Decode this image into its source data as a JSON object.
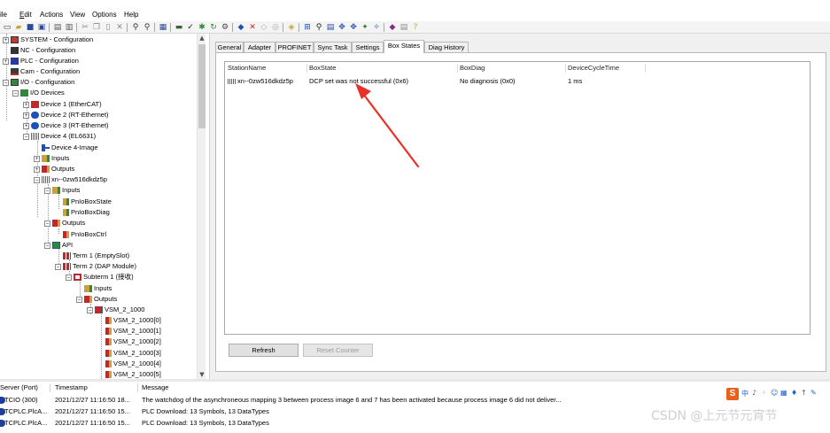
{
  "menu": [
    "ile",
    "Edit",
    "Actions",
    "View",
    "Options",
    "Help"
  ],
  "menu_underline": [
    "",
    "E",
    "A",
    "V",
    "O",
    "H"
  ],
  "toolbar_icons": [
    "new-icon",
    "open-icon",
    "save-icon",
    "save-all-icon",
    "print-icon",
    "print-preview-icon",
    "cut-icon",
    "copy-icon",
    "paste-icon",
    "delete-icon",
    "find-icon",
    "find-next-icon",
    "goto-icon",
    "generate-mappings-icon",
    "check-config-icon",
    "activate-config-icon",
    "restart-icon",
    "login-icon",
    "start-icon",
    "stop-icon",
    "free-run-icon",
    "force-icon",
    "scan-icon",
    "toggle-icon",
    "show-online-icon",
    "zoom-icon",
    "ethercat-icon",
    "online-icon",
    "link-icon",
    "book-icon",
    "help-icon"
  ],
  "tree": [
    {
      "label": "SYSTEM - Configuration",
      "icon": "system-icon",
      "exp": "+"
    },
    {
      "label": "NC - Configuration",
      "icon": "nc-icon",
      "exp": ""
    },
    {
      "label": "PLC - Configuration",
      "icon": "plc-icon",
      "exp": "+"
    },
    {
      "label": "Cam - Configuration",
      "icon": "cam-icon",
      "exp": ""
    },
    {
      "label": "I/O - Configuration",
      "icon": "io-icon",
      "exp": "−"
    },
    {
      "label": "I/O Devices",
      "icon": "io-devices-icon",
      "exp": "−"
    },
    {
      "label": "Device 1 (EtherCAT)",
      "icon": "ethercat-device-icon",
      "exp": "+"
    },
    {
      "label": "Device 2 (RT-Ethernet)",
      "icon": "rt-ethernet-icon",
      "exp": "+"
    },
    {
      "label": "Device 3 (RT-Ethernet)",
      "icon": "rt-ethernet-icon",
      "exp": "+"
    },
    {
      "label": "Device 4 (EL6631)",
      "icon": "profinet-device-icon",
      "exp": "−"
    },
    {
      "label": "Device 4-Image",
      "icon": "image-icon",
      "exp": ""
    },
    {
      "label": "Inputs",
      "icon": "inputs-icon",
      "exp": "+"
    },
    {
      "label": "Outputs",
      "icon": "outputs-icon",
      "exp": "+"
    },
    {
      "label": "xn--0zw516dkdz5p",
      "icon": "box-icon",
      "exp": "−"
    },
    {
      "label": "Inputs",
      "icon": "inputs-icon",
      "exp": "−"
    },
    {
      "label": "PnIoBoxState",
      "icon": "input-var-icon",
      "exp": ""
    },
    {
      "label": "PnIoBoxDiag",
      "icon": "input-var-icon",
      "exp": ""
    },
    {
      "label": "Outputs",
      "icon": "outputs-icon",
      "exp": "−"
    },
    {
      "label": "PnIoBoxCtrl",
      "icon": "output-var-icon",
      "exp": ""
    },
    {
      "label": "API",
      "icon": "api-icon",
      "exp": "−"
    },
    {
      "label": "Term 1 (EmptySlot)",
      "icon": "term-icon",
      "exp": ""
    },
    {
      "label": "Term 2 (DAP Module)",
      "icon": "term-icon",
      "exp": "−"
    },
    {
      "label": "Subterm 1 (接收)",
      "icon": "subterm-icon",
      "exp": "−"
    },
    {
      "label": "Inputs",
      "icon": "inputs-icon",
      "exp": ""
    },
    {
      "label": "Outputs",
      "icon": "outputs-icon",
      "exp": "−"
    },
    {
      "label": "VSM_2_1000",
      "icon": "vsm-icon",
      "exp": "−"
    },
    {
      "label": "VSM_2_1000[0]",
      "icon": "output-var-icon",
      "exp": ""
    },
    {
      "label": "VSM_2_1000[1]",
      "icon": "output-var-icon",
      "exp": ""
    },
    {
      "label": "VSM_2_1000[2]",
      "icon": "output-var-icon",
      "exp": ""
    },
    {
      "label": "VSM_2_1000[3]",
      "icon": "output-var-icon",
      "exp": ""
    },
    {
      "label": "VSM_2_1000[4]",
      "icon": "output-var-icon",
      "exp": ""
    },
    {
      "label": "VSM_2_1000[5]",
      "icon": "output-var-icon",
      "exp": ""
    }
  ],
  "tabs": [
    "General",
    "Adapter",
    "PROFINET",
    "Sync Task",
    "Settings",
    "Box States",
    "Diag History"
  ],
  "active_tab": "Box States",
  "box_states": {
    "columns": [
      "StationName",
      "BoxState",
      "BoxDiag",
      "DeviceCycleTime"
    ],
    "rows": [
      {
        "station": "xn--0zw516dkdz5p",
        "state": "DCP set was not successful (0x6)",
        "diag": "No diagnosis (0x0)",
        "cycle": "1 ms"
      }
    ]
  },
  "buttons": {
    "refresh": "Refresh",
    "reset_counter": "Reset Counter"
  },
  "log": {
    "columns": [
      "Server (Port)",
      "Timestamp",
      "Message"
    ],
    "rows": [
      {
        "server": "TCIO (300)",
        "time": "2021/12/27 11:16:50 18...",
        "message": "The watchdog of the asynchroneous mapping 3 between process image 6 and 7 has been activated because process image 6 did not deliver..."
      },
      {
        "server": "TCPLC.PlcA...",
        "time": "2021/12/27 11:16:50 15...",
        "message": "PLC Download: 13 Symbols, 13 DataTypes"
      },
      {
        "server": "TCPLC.PlcA...",
        "time": "2021/12/27 11:16:50 15...",
        "message": "PLC Download: 13 Symbols, 13 DataTypes"
      }
    ]
  },
  "ime": {
    "logo": "S",
    "glyphs": [
      "中",
      "♪",
      "◦",
      "☺",
      "▦",
      "♦",
      "↑",
      "✎"
    ]
  },
  "watermark": "CSDN @上元节元宵节",
  "colors": {
    "annotation_arrow": "#e8312a",
    "tree_icon_red": "#c0282a",
    "tree_icon_green": "#2e8a3a",
    "tree_icon_blue": "#1f4fb8"
  }
}
